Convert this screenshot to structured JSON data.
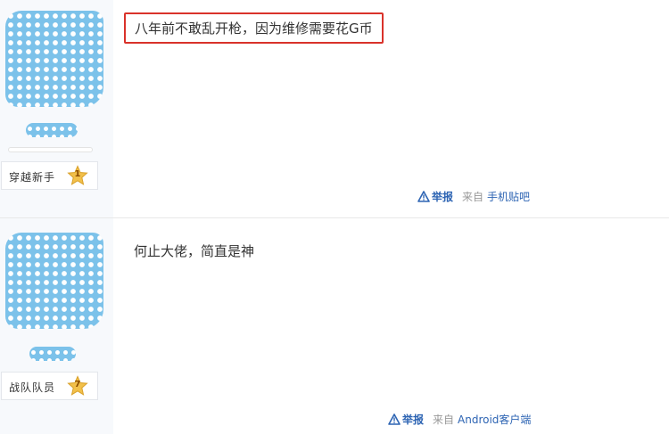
{
  "posts": [
    {
      "level_title": "穿越新手",
      "level_number": "1",
      "content": "八年前不敢乱开枪，因为维修需要花G币",
      "report_label": "举报",
      "source_prefix": "来自",
      "source_link": "手机贴吧",
      "highlighted": true
    },
    {
      "level_title": "战队队员",
      "level_number": "7",
      "content": "何止大佬，简直是神",
      "report_label": "举报",
      "source_prefix": "来自",
      "source_link": "Android客户端",
      "highlighted": false
    }
  ],
  "icons": {
    "report": "warning-triangle-icon",
    "level": "star-icon"
  },
  "colors": {
    "link": "#2d64b3",
    "highlight_border": "#d9322a",
    "avatar_blue": "#7cc2ea",
    "sidebar_bg": "#f7f9fc",
    "level_star": "#f2c04a"
  }
}
